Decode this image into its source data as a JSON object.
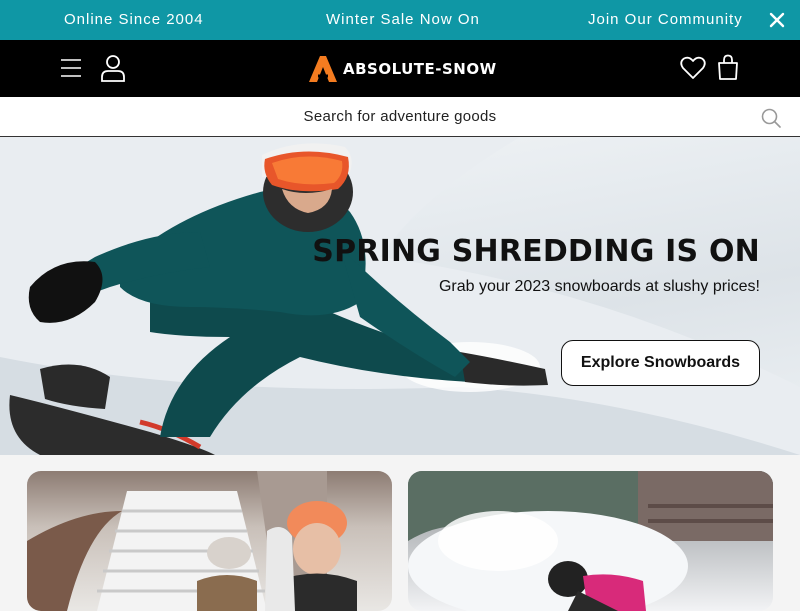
{
  "announcement": {
    "items": [
      "Online Since 2004",
      "Winter Sale Now On",
      "Join Our Community"
    ],
    "close_icon": "close-icon"
  },
  "header": {
    "logo_text": "ABSOLUTE-SNOW",
    "icons": [
      "menu-icon",
      "account-icon",
      "heart-icon",
      "shopping-bag-icon"
    ]
  },
  "search": {
    "placeholder": "Search for adventure goods",
    "icon": "search-icon"
  },
  "hero": {
    "title": "SPRING SHREDDING IS ON",
    "subtitle": "Grab your 2023 snowboards at slushy prices!",
    "cta_label": "Explore Snowboards"
  },
  "colors": {
    "announcement_bg": "#0f97a5",
    "header_bg": "#000000",
    "logo_accent": "#f47c20"
  }
}
